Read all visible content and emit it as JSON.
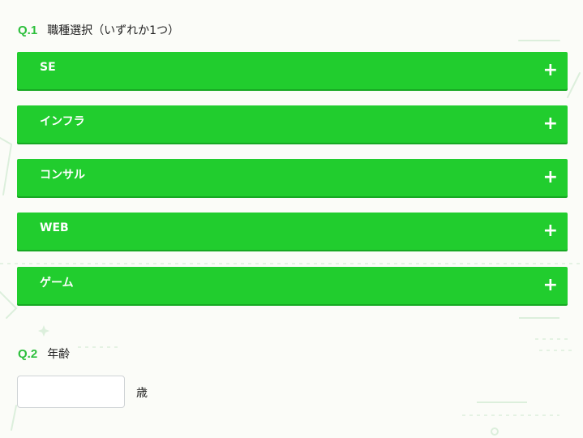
{
  "q1": {
    "num": "Q.1",
    "title": "職種選択（いずれか1つ）"
  },
  "options": [
    {
      "label": "SE",
      "icon": "plus-icon"
    },
    {
      "label": "インフラ",
      "icon": "plus-icon"
    },
    {
      "label": "コンサル",
      "icon": "plus-icon"
    },
    {
      "label": "WEB",
      "icon": "plus-icon"
    },
    {
      "label": "ゲーム",
      "icon": "plus-icon"
    }
  ],
  "q2": {
    "num": "Q.2",
    "title": "年齢",
    "value": "",
    "unit": "歳"
  },
  "colors": {
    "accent": "#21cd2e",
    "question_number": "#2cbf3c",
    "background": "#fbfcf8"
  }
}
